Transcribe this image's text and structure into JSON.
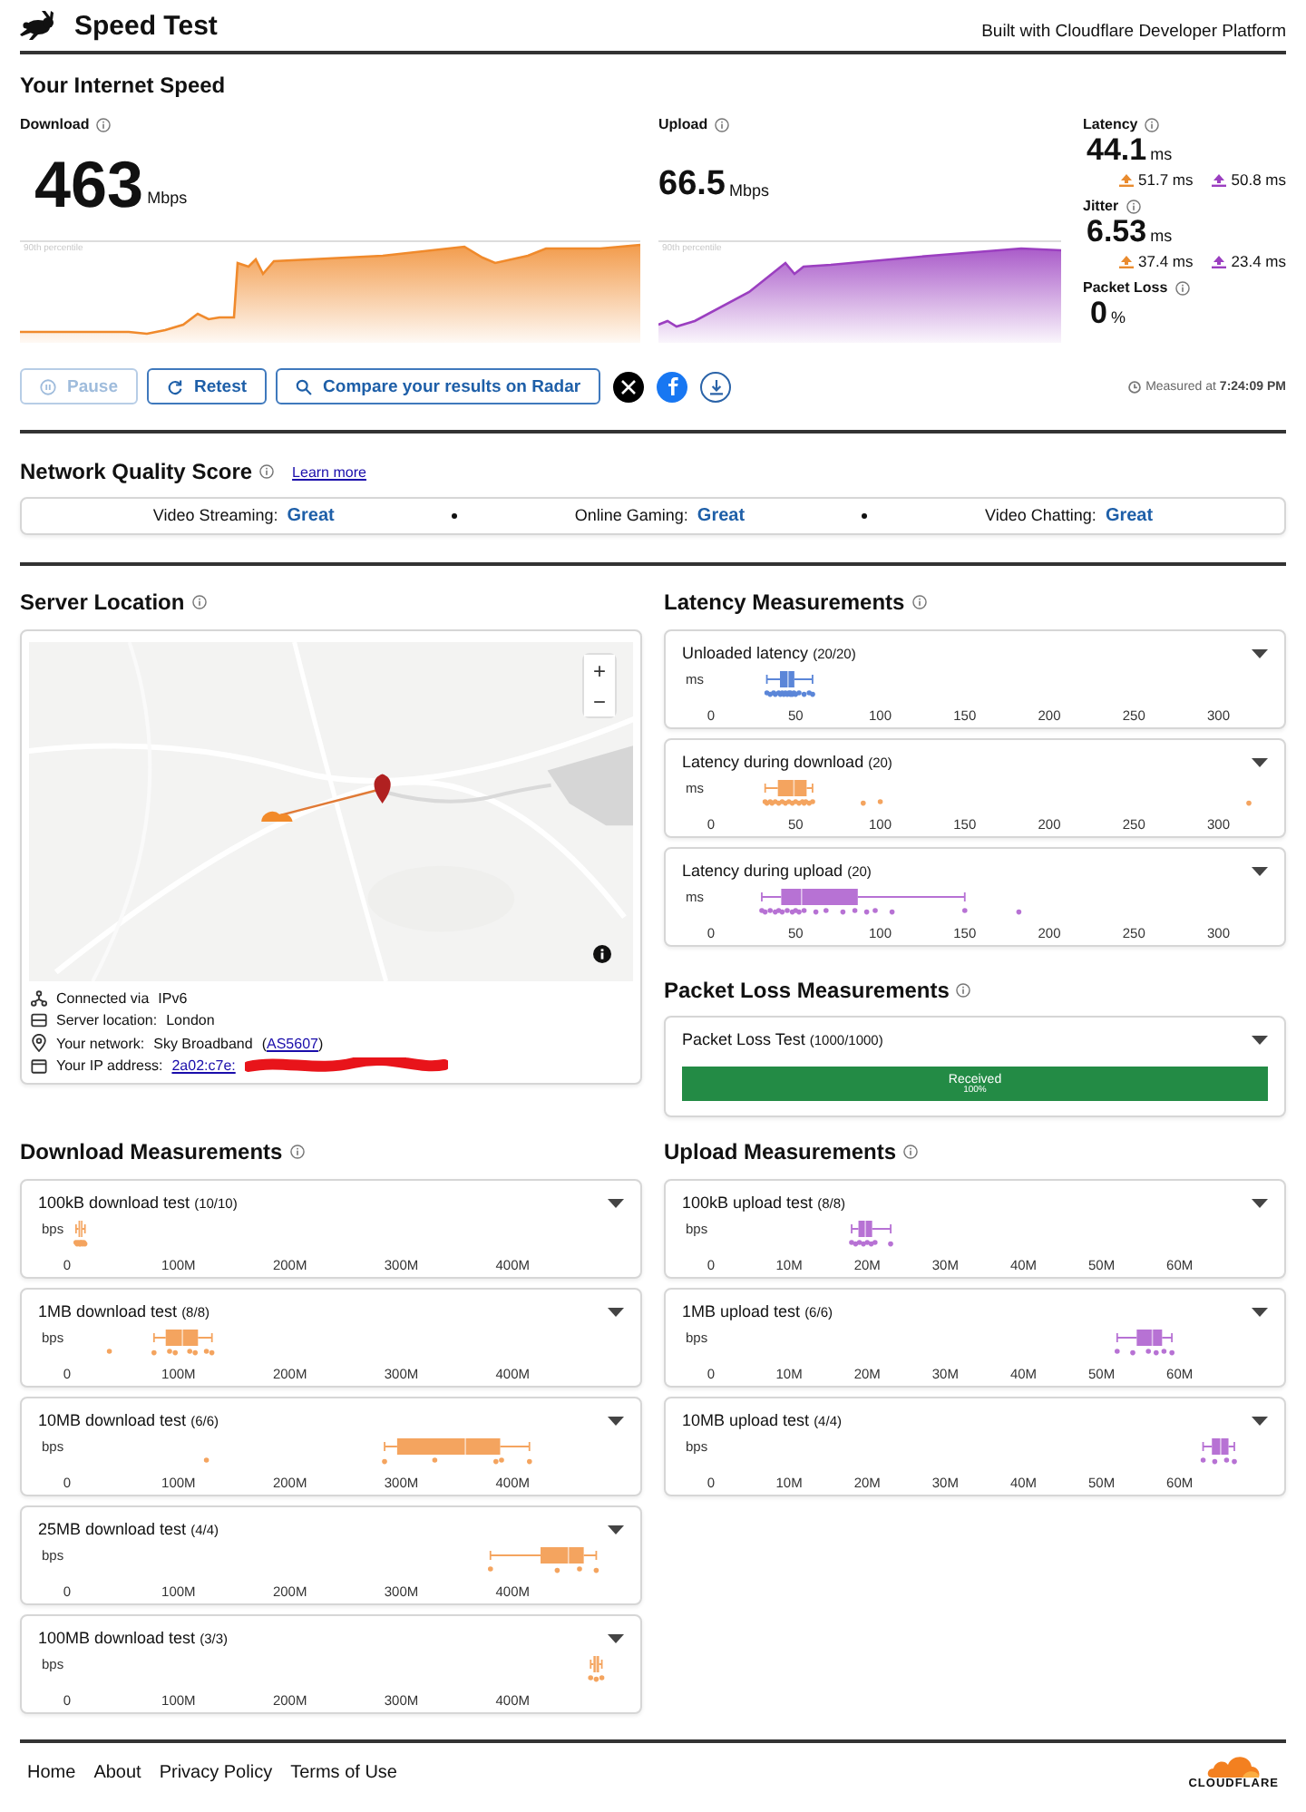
{
  "header": {
    "title": "Speed Test",
    "tagline": "Built with Cloudflare Developer Platform"
  },
  "speed": {
    "heading": "Your Internet Speed",
    "download": {
      "label": "Download",
      "value": "463",
      "unit": "Mbps",
      "percentile_label": "90th percentile"
    },
    "upload": {
      "label": "Upload",
      "value": "66.5",
      "unit": "Mbps",
      "percentile_label": "90th percentile"
    },
    "metrics": [
      {
        "label": "Latency",
        "value": "44.1",
        "unit": "ms",
        "loaded": [
          {
            "kind": "download",
            "value": "51.7 ms"
          },
          {
            "kind": "upload",
            "value": "50.8 ms"
          }
        ]
      },
      {
        "label": "Jitter",
        "value": "6.53",
        "unit": "ms",
        "loaded": [
          {
            "kind": "download",
            "value": "37.4 ms"
          },
          {
            "kind": "upload",
            "value": "23.4 ms"
          }
        ]
      },
      {
        "label": "Packet Loss",
        "value": "0",
        "unit": "%"
      }
    ],
    "actions": [
      {
        "kind": "pause",
        "label": "Pause",
        "disabled": true
      },
      {
        "kind": "retest",
        "label": "Retest",
        "disabled": false
      },
      {
        "kind": "search",
        "label": "Compare your results on Radar",
        "disabled": false
      }
    ],
    "share": [
      {
        "kind": "x"
      },
      {
        "kind": "facebook"
      },
      {
        "kind": "download"
      }
    ],
    "measured": "Measured at **7:24:09 PM**"
  },
  "quality": {
    "heading": "Network Quality Score",
    "link": "Learn more",
    "scores": [
      {
        "label": "Video Streaming:",
        "rating": "Great"
      },
      {
        "label": "Online Gaming:",
        "rating": "Great"
      },
      {
        "label": "Video Chatting:",
        "rating": "Great"
      }
    ]
  },
  "server": {
    "heading": "Server Location",
    "map": {
      "kind": "picture",
      "zoom_in": "+",
      "zoom_out": "−"
    },
    "details": [
      {
        "kind": "network",
        "label": "Connected via",
        "value": "IPv6"
      },
      {
        "kind": "server",
        "label": "Server location:",
        "value": "London"
      },
      {
        "kind": "pin",
        "label": "Your network:",
        "value": "Sky Broadband",
        "link_prefix": "(",
        "link": "AS5607",
        "link_suffix": ")"
      },
      {
        "kind": "card",
        "label": "Your IP address:",
        "link": "2a02:c7e:",
        "redacted": true
      }
    ]
  },
  "latency": {
    "heading": "Latency Measurements",
    "tests": [
      {
        "title": "Unloaded latency",
        "count": "(20/20)",
        "axis": {
          "unit": "ms",
          "ticks": [
            "0",
            "50",
            "100",
            "150",
            "200",
            "250",
            "300"
          ]
        }
      },
      {
        "title": "Latency during download",
        "count": "(20)",
        "axis": {
          "unit": "ms",
          "ticks": [
            "0",
            "50",
            "100",
            "150",
            "200",
            "250",
            "300"
          ]
        }
      },
      {
        "title": "Latency during upload",
        "count": "(20)",
        "axis": {
          "unit": "ms",
          "ticks": [
            "0",
            "50",
            "100",
            "150",
            "200",
            "250",
            "300"
          ]
        }
      }
    ]
  },
  "packet_loss": {
    "heading": "Packet Loss Measurements",
    "test": {
      "title": "Packet Loss Test",
      "count": "(1000/1000)",
      "label": "Received",
      "percent": "100%",
      "level": 1
    }
  },
  "download_tests": {
    "heading": "Download Measurements",
    "tests": [
      {
        "title": "100kB download test",
        "count": "(10/10)",
        "axis": {
          "unit": "bps",
          "ticks": [
            "0",
            "100M",
            "200M",
            "300M",
            "400M"
          ]
        }
      },
      {
        "title": "1MB download test",
        "count": "(8/8)",
        "axis": {
          "unit": "bps",
          "ticks": [
            "0",
            "100M",
            "200M",
            "300M",
            "400M"
          ]
        }
      },
      {
        "title": "10MB download test",
        "count": "(6/6)",
        "axis": {
          "unit": "bps",
          "ticks": [
            "0",
            "100M",
            "200M",
            "300M",
            "400M"
          ]
        }
      },
      {
        "title": "25MB download test",
        "count": "(4/4)",
        "axis": {
          "unit": "bps",
          "ticks": [
            "0",
            "100M",
            "200M",
            "300M",
            "400M"
          ]
        }
      },
      {
        "title": "100MB download test",
        "count": "(3/3)",
        "axis": {
          "unit": "bps",
          "ticks": [
            "0",
            "100M",
            "200M",
            "300M",
            "400M"
          ]
        }
      }
    ]
  },
  "upload_tests": {
    "heading": "Upload Measurements",
    "tests": [
      {
        "title": "100kB upload test",
        "count": "(8/8)",
        "axis": {
          "unit": "bps",
          "ticks": [
            "0",
            "10M",
            "20M",
            "30M",
            "40M",
            "50M",
            "60M"
          ]
        }
      },
      {
        "title": "1MB upload test",
        "count": "(6/6)",
        "axis": {
          "unit": "bps",
          "ticks": [
            "0",
            "10M",
            "20M",
            "30M",
            "40M",
            "50M",
            "60M"
          ]
        }
      },
      {
        "title": "10MB upload test",
        "count": "(4/4)",
        "axis": {
          "unit": "bps",
          "ticks": [
            "0",
            "10M",
            "20M",
            "30M",
            "40M",
            "50M",
            "60M"
          ]
        }
      }
    ]
  },
  "footer": {
    "links": [
      "Home",
      "About",
      "Privacy Policy",
      "Terms of Use"
    ],
    "logo": "CLOUDFLARE"
  }
}
